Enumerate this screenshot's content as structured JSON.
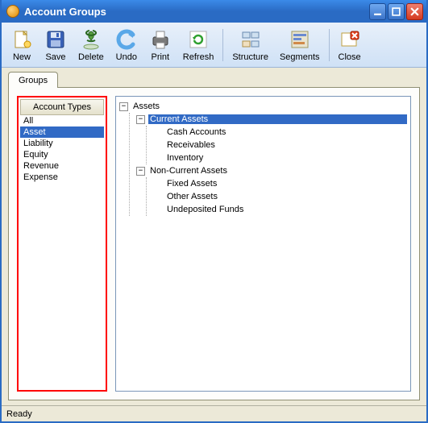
{
  "window": {
    "title": "Account Groups"
  },
  "toolbar": {
    "new": "New",
    "save": "Save",
    "delete": "Delete",
    "undo": "Undo",
    "print": "Print",
    "refresh": "Refresh",
    "structure": "Structure",
    "segments": "Segments",
    "close": "Close"
  },
  "tabs": {
    "groups": "Groups"
  },
  "left": {
    "header": "Account Types",
    "items": [
      "All",
      "Asset",
      "Liability",
      "Equity",
      "Revenue",
      "Expense"
    ],
    "selected_index": 1
  },
  "tree": {
    "root": {
      "label": "Assets",
      "expanded": true,
      "children": [
        {
          "label": "Current Assets",
          "expanded": true,
          "selected": true,
          "children": [
            {
              "label": "Cash Accounts"
            },
            {
              "label": "Receivables"
            },
            {
              "label": "Inventory"
            }
          ]
        },
        {
          "label": "Non-Current Assets",
          "expanded": true,
          "children": [
            {
              "label": "Fixed Assets"
            },
            {
              "label": "Other Assets"
            },
            {
              "label": "Undeposited Funds"
            }
          ]
        }
      ]
    }
  },
  "status": "Ready",
  "colors": {
    "selection": "#316ac5",
    "highlight_border": "#ff0000"
  }
}
